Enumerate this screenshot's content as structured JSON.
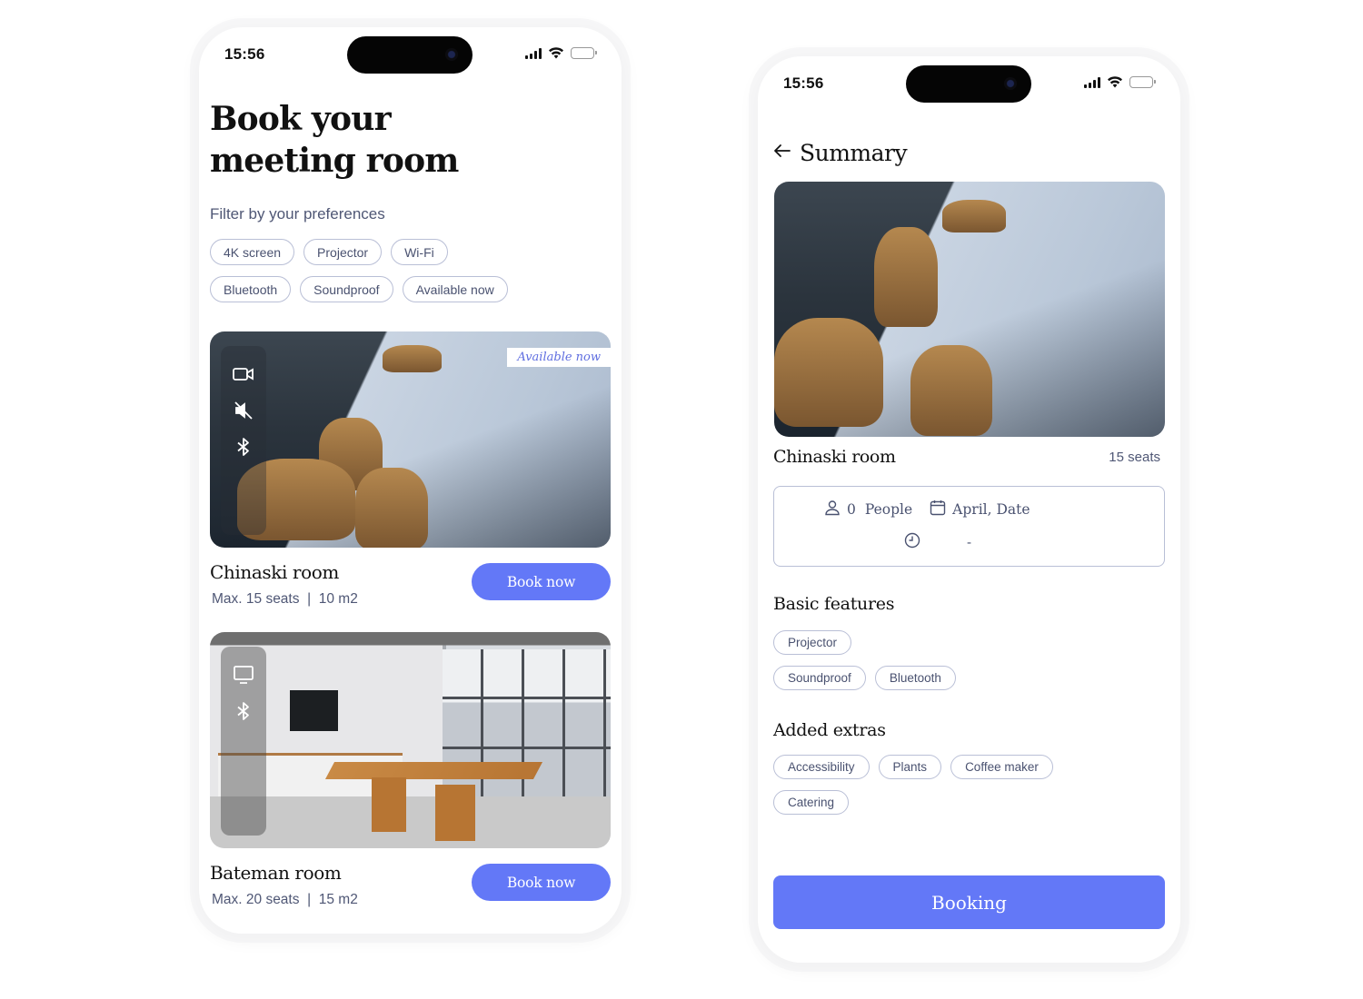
{
  "theme": {
    "accent": "#6378f7",
    "chip_border": "#b9bfd6",
    "muted_text": "#4f5775",
    "badge_text": "#5f6ee0"
  },
  "status_bar": {
    "time": "15:56",
    "icons": [
      "cellular-signal-icon",
      "wifi-icon",
      "battery-icon"
    ]
  },
  "browse_screen": {
    "title_line1": "Book your",
    "title_line2": "meeting room",
    "filter_label": "Filter by your preferences",
    "filters": [
      "4K screen",
      "Projector",
      "Wi-Fi",
      "Bluetooth",
      "Soundproof",
      "Available now"
    ],
    "rooms": [
      {
        "name": "Chinaski room",
        "meta": "Max. 15 seats  |  10 m2",
        "badge": "Available now",
        "feature_icons": [
          "video-camera-icon",
          "speaker-muted-icon",
          "bluetooth-icon"
        ],
        "button_label": "Book now"
      },
      {
        "name": "Bateman room",
        "meta": "Max. 20 seats  |  15 m2",
        "feature_icons": [
          "monitor-icon",
          "bluetooth-icon"
        ],
        "button_label": "Book now"
      }
    ]
  },
  "summary_screen": {
    "back_icon": "arrow-left-icon",
    "title": "Summary",
    "room_name": "Chinaski room",
    "seats": "15  seats",
    "people_count": "0",
    "people_label": "People",
    "date_label": "April, Date",
    "time_value": "-",
    "basic_features_title": "Basic features",
    "basic_features": [
      "Projector",
      "Soundproof",
      "Bluetooth"
    ],
    "extras_title": "Added extras",
    "extras": [
      "Accessibility",
      "Plants",
      "Coffee maker",
      "Catering"
    ],
    "booking_label": "Booking"
  }
}
